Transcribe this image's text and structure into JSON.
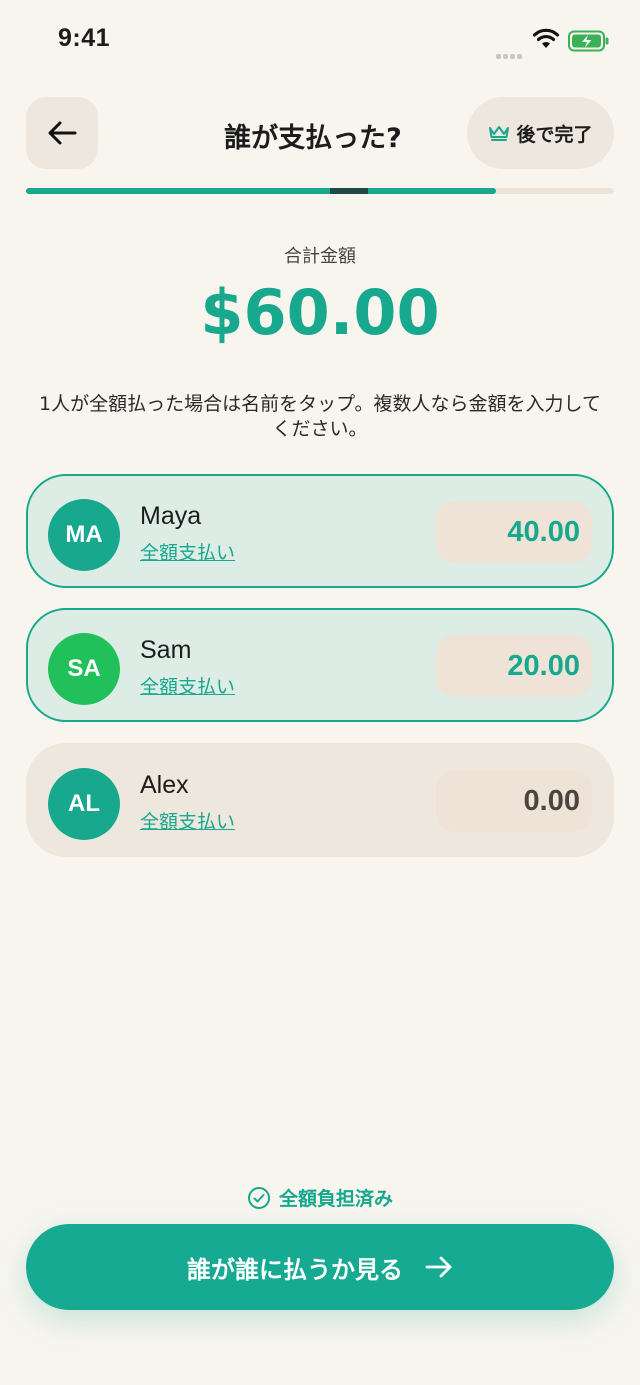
{
  "status_bar": {
    "time": "9:41"
  },
  "header": {
    "title": "誰が支払った?",
    "later_label": "後で完了"
  },
  "progress": {
    "value": 0.8
  },
  "total": {
    "label": "合計金額",
    "amount": "$60.00"
  },
  "instructions": "1人が全額払った場合は名前をタップ。複数人なら金額を入力してください。",
  "payers": [
    {
      "initials": "MA",
      "name": "Maya",
      "link": "全額支払い",
      "amount": "40.00",
      "avatar_color": "#17A88E",
      "active": true
    },
    {
      "initials": "SA",
      "name": "Sam",
      "link": "全額支払い",
      "amount": "20.00",
      "avatar_color": "#22C05A",
      "active": true
    },
    {
      "initials": "AL",
      "name": "Alex",
      "link": "全額支払い",
      "amount": "0.00",
      "avatar_color": "#17A88E",
      "active": false
    }
  ],
  "footer": {
    "fully_paid": "全額負担済み",
    "cta_label": "誰が誰に払うか見る"
  },
  "colors": {
    "accent": "#17A88E",
    "background": "#F8F5EF",
    "card_active": "#DDEDE6",
    "card_inactive": "#EEE7DD",
    "amount_active": "#17A88E",
    "amount_inactive": "#4A4540"
  },
  "icons": {
    "back": "arrow-left-icon",
    "later": "crown-icon",
    "fully_paid": "check-circle-icon",
    "cta": "arrow-right-icon"
  }
}
